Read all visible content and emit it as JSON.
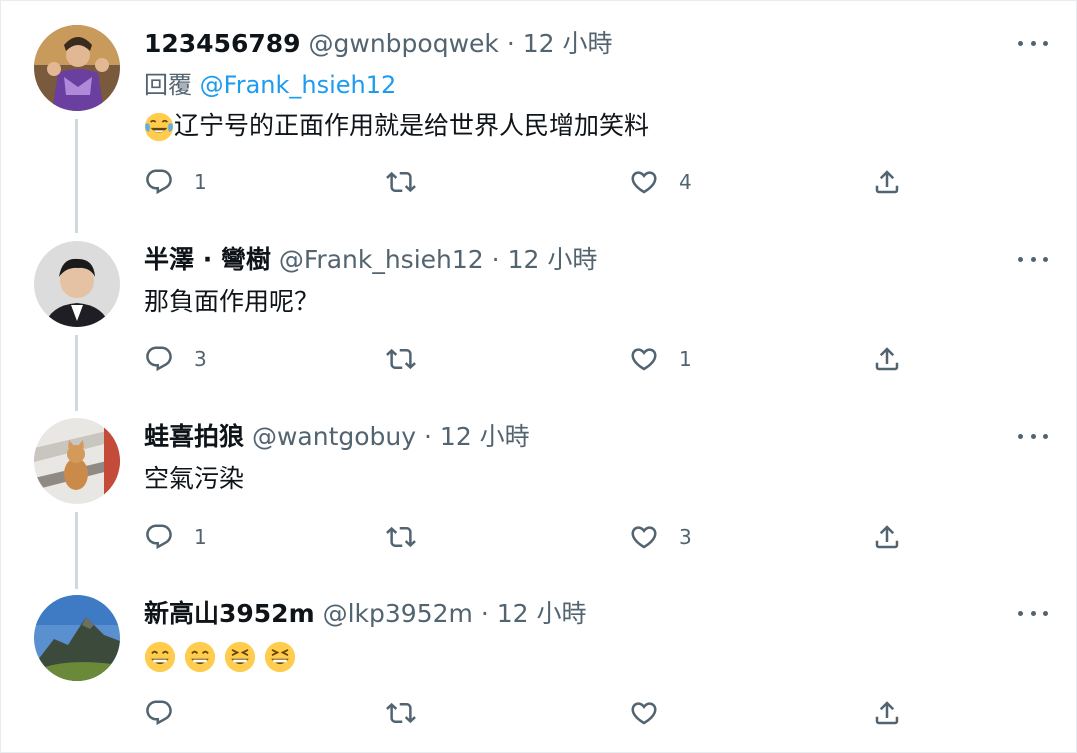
{
  "tweets": [
    {
      "name": "123456789",
      "handle": "@gwnbpoqwek",
      "separator": "·",
      "time": "12 小時",
      "reply_label": "回覆",
      "reply_mention": "@Frank_hsieh12",
      "text": "辽宁号的正面作用就是给世界人民增加笑料",
      "emoji": [
        "face-with-tears-of-joy"
      ],
      "replies": "1",
      "retweets": "",
      "likes": "4",
      "avatar_icon": "warrior-character-avatar"
    },
    {
      "name": "半澤 · 彎樹",
      "handle": "@Frank_hsieh12",
      "separator": "·",
      "time": "12 小時",
      "text": "那負面作用呢？",
      "replies": "3",
      "retweets": "",
      "likes": "1",
      "avatar_icon": "man-in-suit-avatar"
    },
    {
      "name": "蛙喜拍狼",
      "handle": "@wantgobuy",
      "separator": "·",
      "time": "12 小時",
      "text": "空氣污染",
      "replies": "1",
      "retweets": "",
      "likes": "3",
      "avatar_icon": "cat-avatar"
    },
    {
      "name": "新高山3952m",
      "handle": "@lkp3952m",
      "separator": "·",
      "time": "12 小時",
      "text": "",
      "emoji": [
        "grinning-face-with-smiling-eyes",
        "grinning-face-with-smiling-eyes",
        "grinning-squinting-face",
        "grinning-squinting-face"
      ],
      "replies": "",
      "retweets": "",
      "likes": "",
      "avatar_icon": "mountain-avatar"
    }
  ],
  "colors": {
    "text": "#0f1419",
    "secondary": "#536471",
    "link": "#1d9bf0",
    "thread_line": "#cfd9de"
  },
  "icons": [
    "reply-icon",
    "retweet-icon",
    "like-icon",
    "share-icon",
    "more-icon"
  ]
}
